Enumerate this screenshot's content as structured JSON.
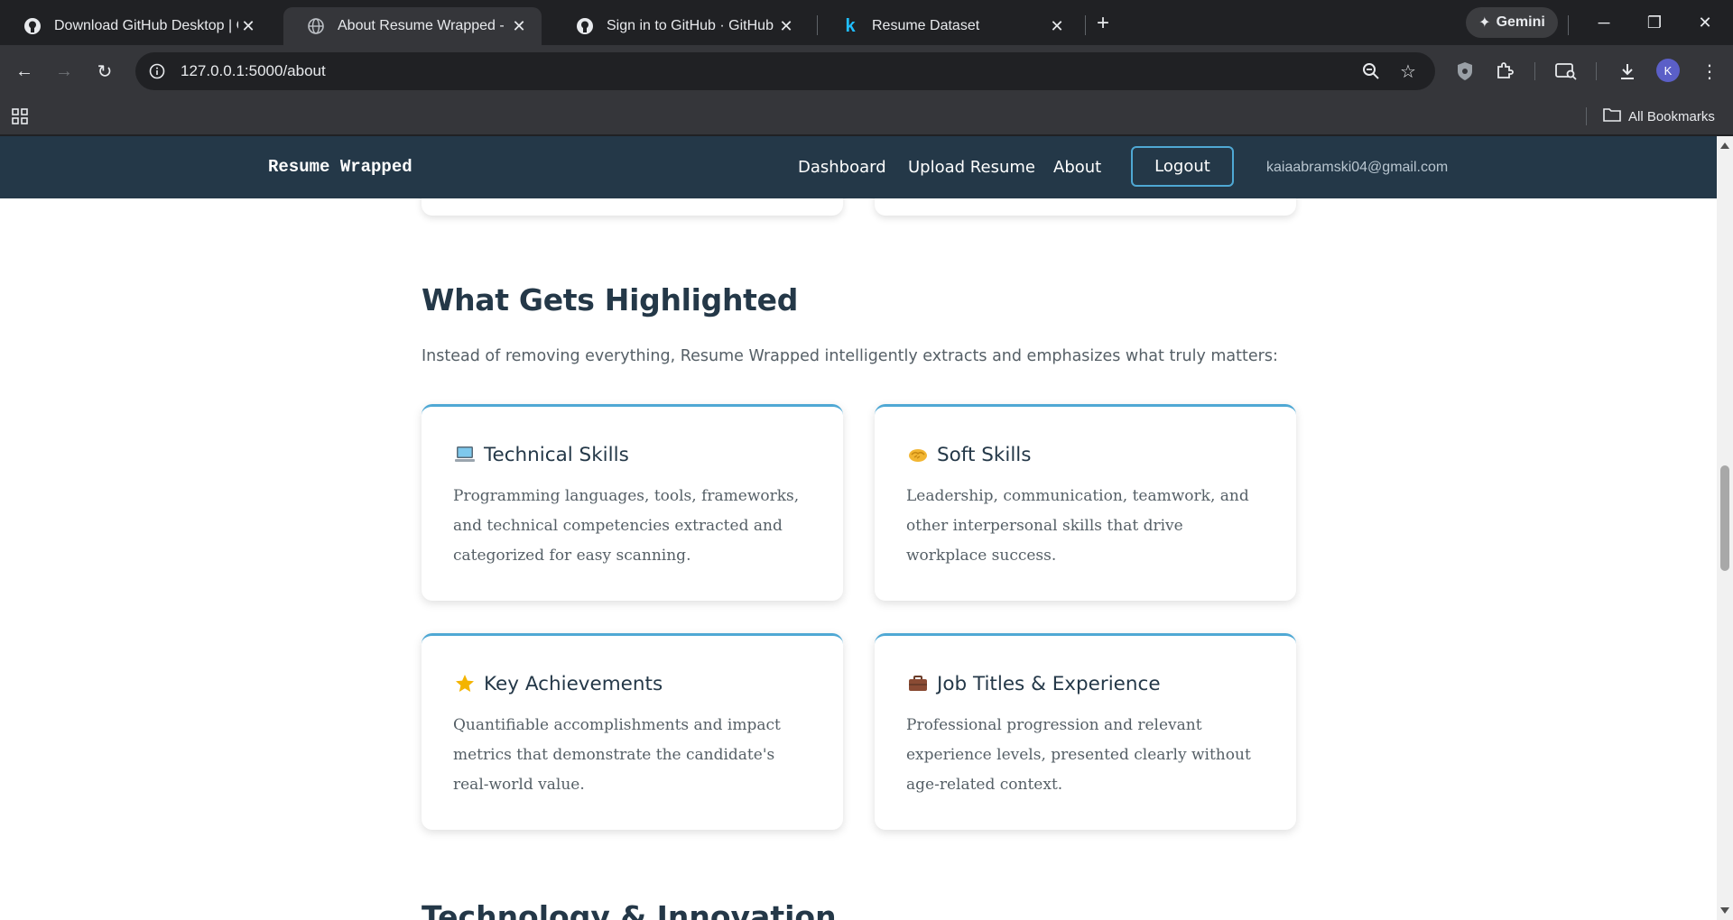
{
  "browser": {
    "tabs": [
      {
        "title": "Download GitHub Desktop | GitHub",
        "icon": "github-icon",
        "active": false
      },
      {
        "title": "About Resume Wrapped - Fair Hiring",
        "icon": "globe-icon",
        "active": true
      },
      {
        "title": "Sign in to GitHub · GitHub",
        "icon": "github-icon",
        "active": false
      },
      {
        "title": "Resume Dataset",
        "icon": "kaggle-icon",
        "active": false
      }
    ],
    "gemini_label": "Gemini",
    "url": "127.0.0.1:5000/about",
    "profile_initial": "K",
    "bookmarks_label": "All Bookmarks"
  },
  "site": {
    "brand": "Resume Wrapped",
    "nav": {
      "dashboard": "Dashboard",
      "upload": "Upload Resume",
      "about": "About",
      "logout": "Logout",
      "email": "kaiaabramski04@gmail.com"
    }
  },
  "section": {
    "title": "What Gets Highlighted",
    "intro": "Instead of removing everything, Resume Wrapped intelligently extracts and emphasizes what truly matters:",
    "cards": [
      {
        "emoji": "💻",
        "icon": "laptop-icon",
        "title": "Technical Skills",
        "text": "Programming languages, tools, frameworks, and technical competencies extracted and categorized for easy scanning."
      },
      {
        "emoji": "🤝",
        "icon": "handshake-icon",
        "title": "Soft Skills",
        "text": "Leadership, communication, teamwork, and other interpersonal skills that drive workplace success."
      },
      {
        "emoji": "⭐",
        "icon": "star-icon",
        "title": "Key Achievements",
        "text": "Quantifiable accomplishments and impact metrics that demonstrate the candidate's real-world value."
      },
      {
        "emoji": "💼",
        "icon": "briefcase-icon",
        "title": "Job Titles & Experience",
        "text": "Professional progression and relevant experience levels, presented clearly without age-related context."
      }
    ]
  },
  "next_section": {
    "title": "Technology & Innovation"
  },
  "colors": {
    "nav_bg": "#243848",
    "accent": "#4fa8d4",
    "heading": "#243848",
    "body_text": "#555f66"
  }
}
